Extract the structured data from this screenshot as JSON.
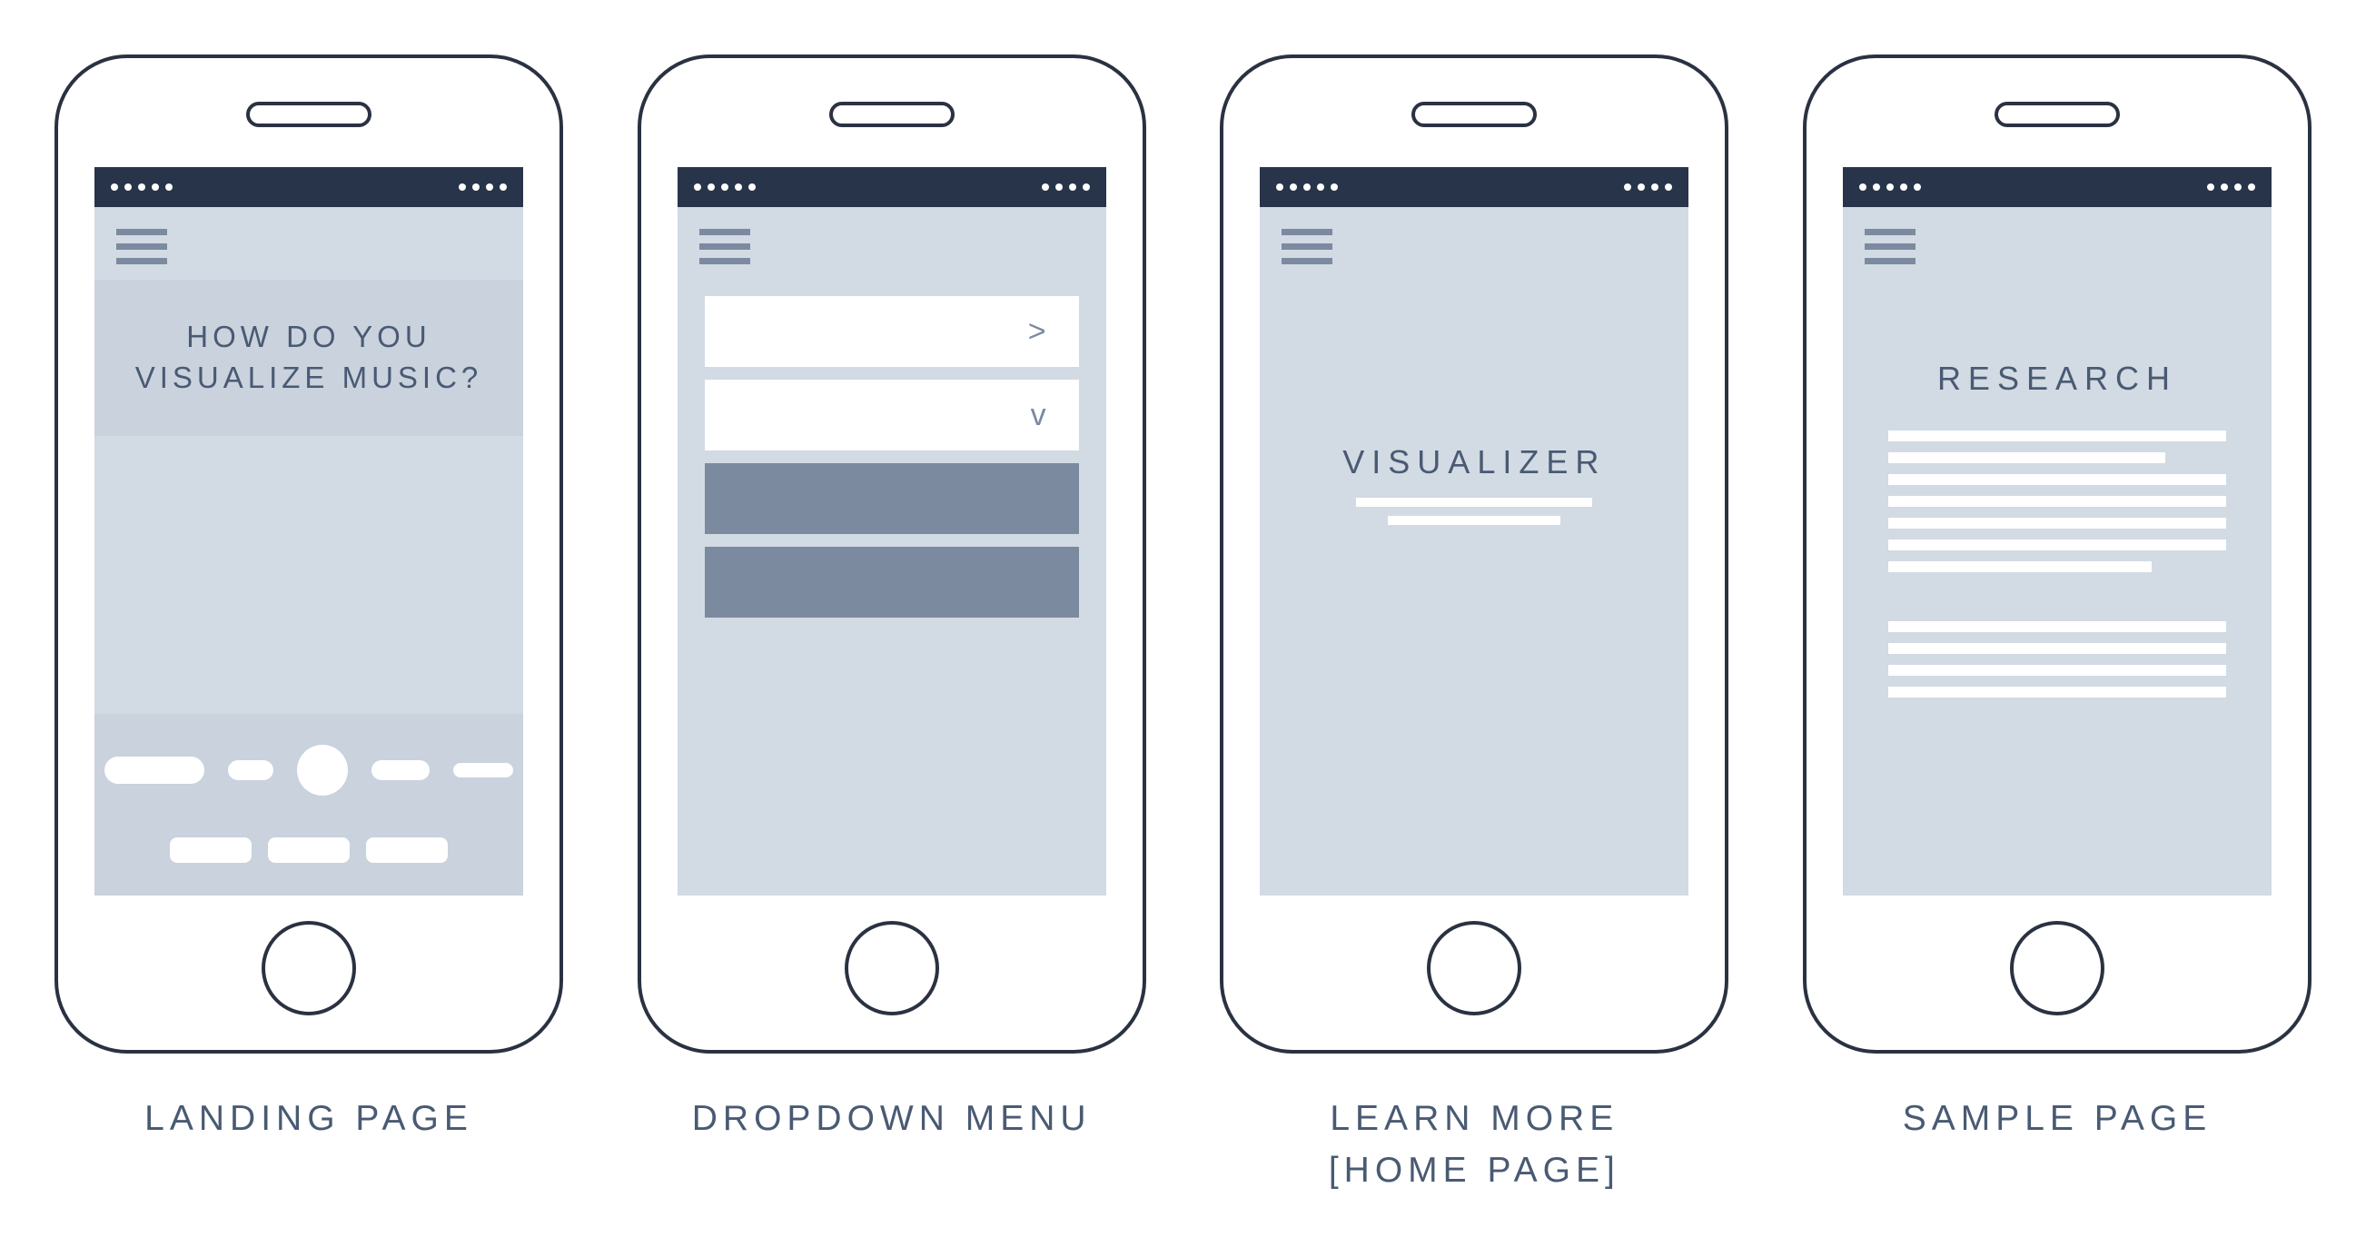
{
  "frames": [
    {
      "caption": "LANDING PAGE",
      "hero_text": "HOW DO YOU\nVISUALIZE MUSIC?"
    },
    {
      "caption": "DROPDOWN MENU",
      "menu_items": [
        {
          "style": "white",
          "chevron": ">"
        },
        {
          "style": "white",
          "chevron": "v"
        },
        {
          "style": "slate",
          "chevron": ""
        },
        {
          "style": "slate",
          "chevron": ""
        }
      ]
    },
    {
      "caption": "LEARN MORE\n[HOME PAGE]",
      "title": "VISUALIZER"
    },
    {
      "caption": "SAMPLE PAGE",
      "title": "RESEARCH"
    }
  ]
}
